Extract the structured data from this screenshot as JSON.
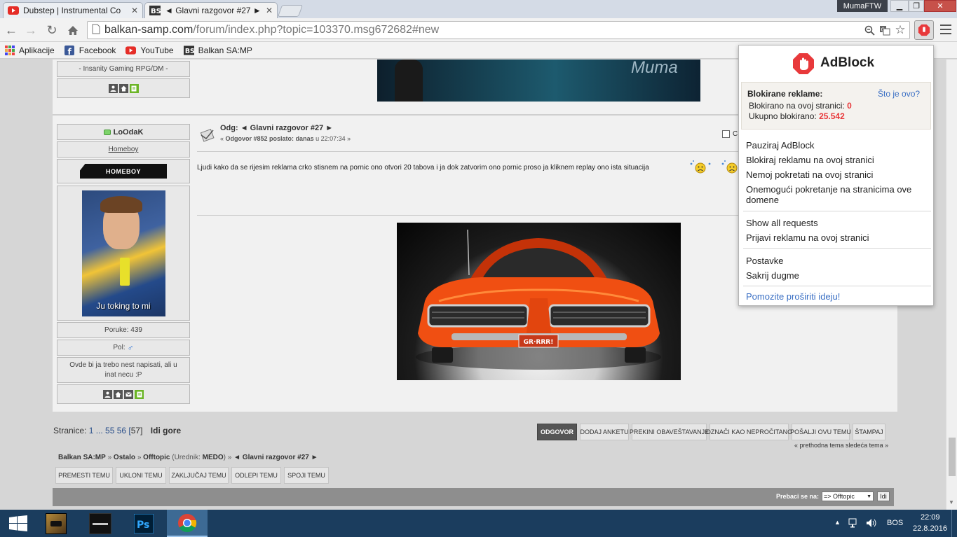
{
  "browser": {
    "tabs": [
      {
        "title": "Dubstep | Instrumental Co",
        "icon": "youtube-icon"
      },
      {
        "title": "◄ Glavni razgovor #27 ►",
        "icon": "bs-icon"
      }
    ],
    "user_label": "MumaFTW",
    "url_host": "balkan-samp.com",
    "url_path": "/forum/index.php?topic=103370.msg672682#new",
    "bookmarks": [
      {
        "label": "Aplikacije",
        "icon": "apps-grid-icon"
      },
      {
        "label": "Facebook",
        "icon": "facebook-icon"
      },
      {
        "label": "YouTube",
        "icon": "youtube-icon"
      },
      {
        "label": "Balkan SA:MP",
        "icon": "bs-icon"
      }
    ]
  },
  "forum": {
    "prev_post": {
      "group_text": "- Insanity Gaming RPG/DM -",
      "signature_text": "Muma"
    },
    "post": {
      "username": "LoOdaK",
      "usertitle": "Homeboy",
      "badge_text": "HOMEBOY",
      "avatar_caption": "Ju toking to mi",
      "posts_count": "Poruke: 439",
      "gender_label": "Pol:",
      "user_text": "Ovde bi ja trebo nest napisati, ali u inat necu :P",
      "subject": "Odg: ◄ Glavni razgovor #27 ►",
      "meta_prefix": "« ",
      "meta_reply": "Odgovor #852 poslato:",
      "meta_when": "danas",
      "meta_time": "u 22:07:34 »",
      "quote_label": "C",
      "body": "Ljudi kako da se rijesim reklama crko stisnem na pornic ono otvori 20 tabova i ja dok zatvorim ono pornic proso ja kliknem replay ono ista situacija",
      "plate_text": "GR·RRR!"
    },
    "pagination": {
      "label": "Stranice:",
      "pages": "1 ... 55 56 [",
      "current": "57",
      "close": "]",
      "goto_top": "Idi gore"
    },
    "actions": [
      "ODGOVOR",
      "DODAJ ANKETU",
      "PREKINI OBAVEŠTAVANJE",
      "OZNAČI KAO NEPROČITANO",
      "POŠALJI OVU TEMU",
      "ŠTAMPAJ"
    ],
    "prev_next": "« prethodna tema sledeća tema »",
    "breadcrumb": {
      "site": "Balkan SA:MP",
      "sep": "»",
      "section": "Ostalo",
      "board": "Offtopic",
      "moderator_prefix": "(Urednik:",
      "moderator": "MEDO",
      "moderator_suffix": ")",
      "topic": "◄ Glavni razgovor #27 ►"
    },
    "mod_actions": [
      "PREMESTI TEMU",
      "UKLONI TEMU",
      "ZAKLJUČAJ TEMU",
      "ODLEPI TEMU",
      "SPOJI TEMU"
    ],
    "jump": {
      "label": "Prebaci se na:",
      "value": "=> Offtopic",
      "button": "Idi"
    }
  },
  "adblock": {
    "title": "AdBlock",
    "blocked_heading": "Blokirane reklame:",
    "whats_this": "Što je ovo?",
    "on_page_label": "Blokirano na ovoj stranici:",
    "on_page_count": "0",
    "total_label": "Ukupno blokirano:",
    "total_count": "25.542",
    "menu_group1": [
      "Pauziraj AdBlock",
      "Blokiraj reklamu na ovoj stranici",
      "Nemoj pokretati na ovoj stranici",
      "Onemogući pokretanje na stranicima ove domene"
    ],
    "menu_group2": [
      "Show all requests",
      "Prijavi reklamu na ovoj stranici"
    ],
    "menu_group3": [
      "Postavke",
      "Sakrij dugme"
    ],
    "help_link": "Pomozite proširiti ideju!",
    "accent_color": "#e8393b",
    "link_color": "#3a6fc4"
  },
  "taskbar": {
    "apps": [
      "windows-start-icon",
      "gta-sa-icon",
      "counter-strike-icon",
      "photoshop-icon",
      "chrome-icon"
    ],
    "language": "BOS",
    "time": "22:09",
    "date": "22.8.2016"
  }
}
